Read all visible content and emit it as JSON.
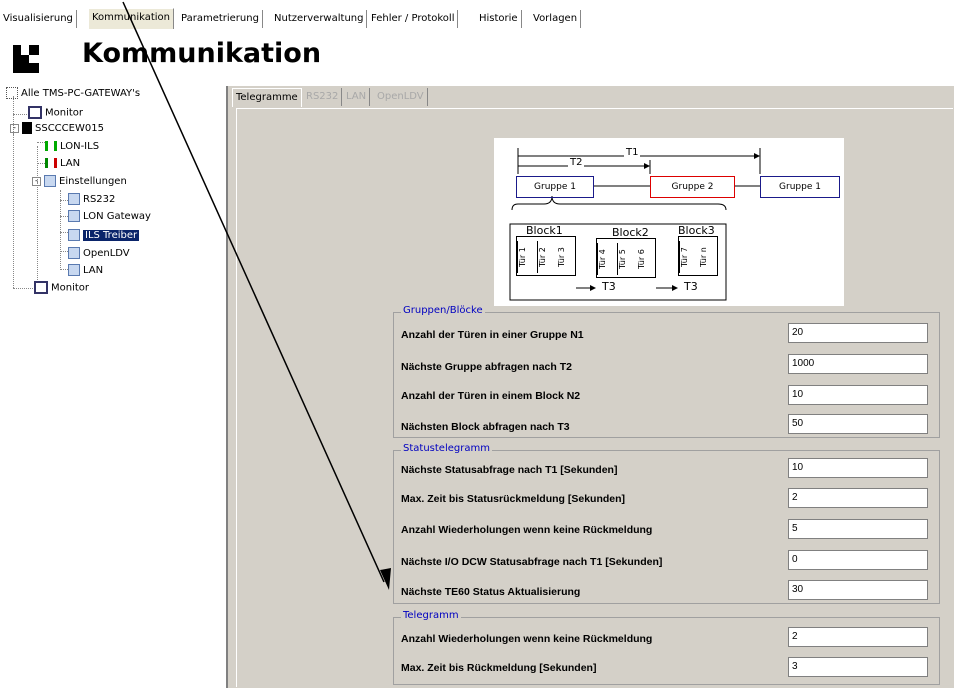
{
  "main_tabs": [
    "Visualisierung",
    "Kommunikation",
    "Parametrierung",
    "Nutzerverwaltung",
    "Fehler / Protokoll",
    "Historie",
    "Vorlagen"
  ],
  "page_title": "Kommunikation",
  "tree": {
    "root": "Alle TMS-PC-GATEWAY's",
    "monitor1": "Monitor",
    "device": "SSCCCEW015",
    "lon_ils": "LON-ILS",
    "lan": "LAN",
    "einstellungen": "Einstellungen",
    "rs232": "RS232",
    "lon_gateway": "LON Gateway",
    "ils_treiber": "ILS Treiber",
    "openldv": "OpenLDV",
    "lan2": "LAN",
    "monitor2": "Monitor"
  },
  "sub_tabs": [
    "Telegramme",
    "RS232",
    "LAN",
    "OpenLDV"
  ],
  "diagram": {
    "t1": "T1",
    "t2": "T2",
    "g1": "Gruppe 1",
    "g2": "Gruppe 2",
    "g3": "Gruppe 1",
    "b1": "Block1",
    "b2": "Block2",
    "b3": "Block3",
    "doors": [
      "Tür 1",
      "Tür 2",
      "Tür 3",
      "Tür 4",
      "Tür 5",
      "Tür 6",
      "Tür 7",
      "Tür n"
    ],
    "t3a": "T3",
    "t3b": "T3"
  },
  "groups": {
    "gruppen": {
      "legend": "Gruppen/Blöcke",
      "rows": [
        {
          "label": "Anzahl der Türen in einer Gruppe N1",
          "value": "20"
        },
        {
          "label": "Nächste Gruppe abfragen nach T2",
          "value": "1000"
        },
        {
          "label": "Anzahl der Türen in einem Block N2",
          "value": "10"
        },
        {
          "label": "Nächsten Block abfragen nach T3",
          "value": "50"
        }
      ]
    },
    "status": {
      "legend": "Statustelegramm",
      "rows": [
        {
          "label": "Nächste Statusabfrage nach T1 [Sekunden]",
          "value": "10"
        },
        {
          "label": "Max. Zeit bis Statusrückmeldung [Sekunden]",
          "value": "2"
        },
        {
          "label": "Anzahl Wiederholungen wenn keine Rückmeldung",
          "value": "5"
        },
        {
          "label": "Nächste I/O DCW Statusabfrage nach T1 [Sekunden]",
          "value": "0"
        },
        {
          "label": "Nächste TE60 Status Aktualisierung",
          "value": "30"
        }
      ]
    },
    "telegramm": {
      "legend": "Telegramm",
      "rows": [
        {
          "label": "Anzahl Wiederholungen wenn keine Rückmeldung",
          "value": "2"
        },
        {
          "label": "Max. Zeit bis Rückmeldung [Sekunden]",
          "value": "3"
        }
      ]
    }
  }
}
